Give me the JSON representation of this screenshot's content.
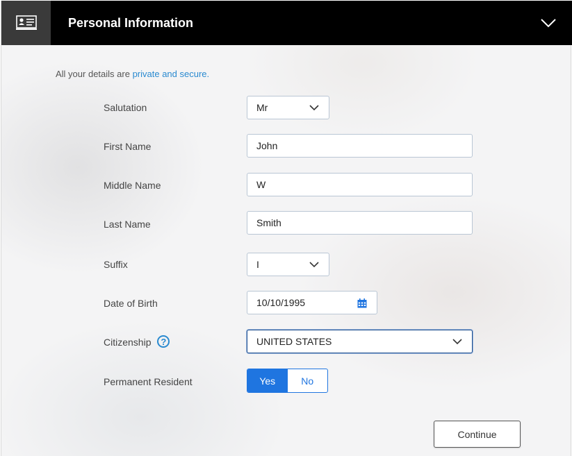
{
  "header": {
    "title": "Personal Information",
    "icon": "id-card-icon",
    "collapse_icon": "chevron-down-icon"
  },
  "intro": {
    "text": "All your details are ",
    "link": "private and secure."
  },
  "form": {
    "salutation": {
      "label": "Salutation",
      "value": "Mr"
    },
    "first_name": {
      "label": "First Name",
      "value": "John"
    },
    "middle_name": {
      "label": "Middle Name",
      "value": "W"
    },
    "last_name": {
      "label": "Last Name",
      "value": "Smith"
    },
    "suffix": {
      "label": "Suffix",
      "value": "I"
    },
    "dob": {
      "label": "Date of Birth",
      "value": "10/10/1995"
    },
    "citizenship": {
      "label": "Citizenship",
      "value": "UNITED STATES",
      "help": "?"
    },
    "permanent_resident": {
      "label": "Permanent Resident",
      "yes": "Yes",
      "no": "No",
      "selected": "Yes"
    }
  },
  "actions": {
    "continue": "Continue"
  },
  "colors": {
    "header": "#000000",
    "accent": "#1f75e0",
    "link": "#2a8ad0"
  }
}
